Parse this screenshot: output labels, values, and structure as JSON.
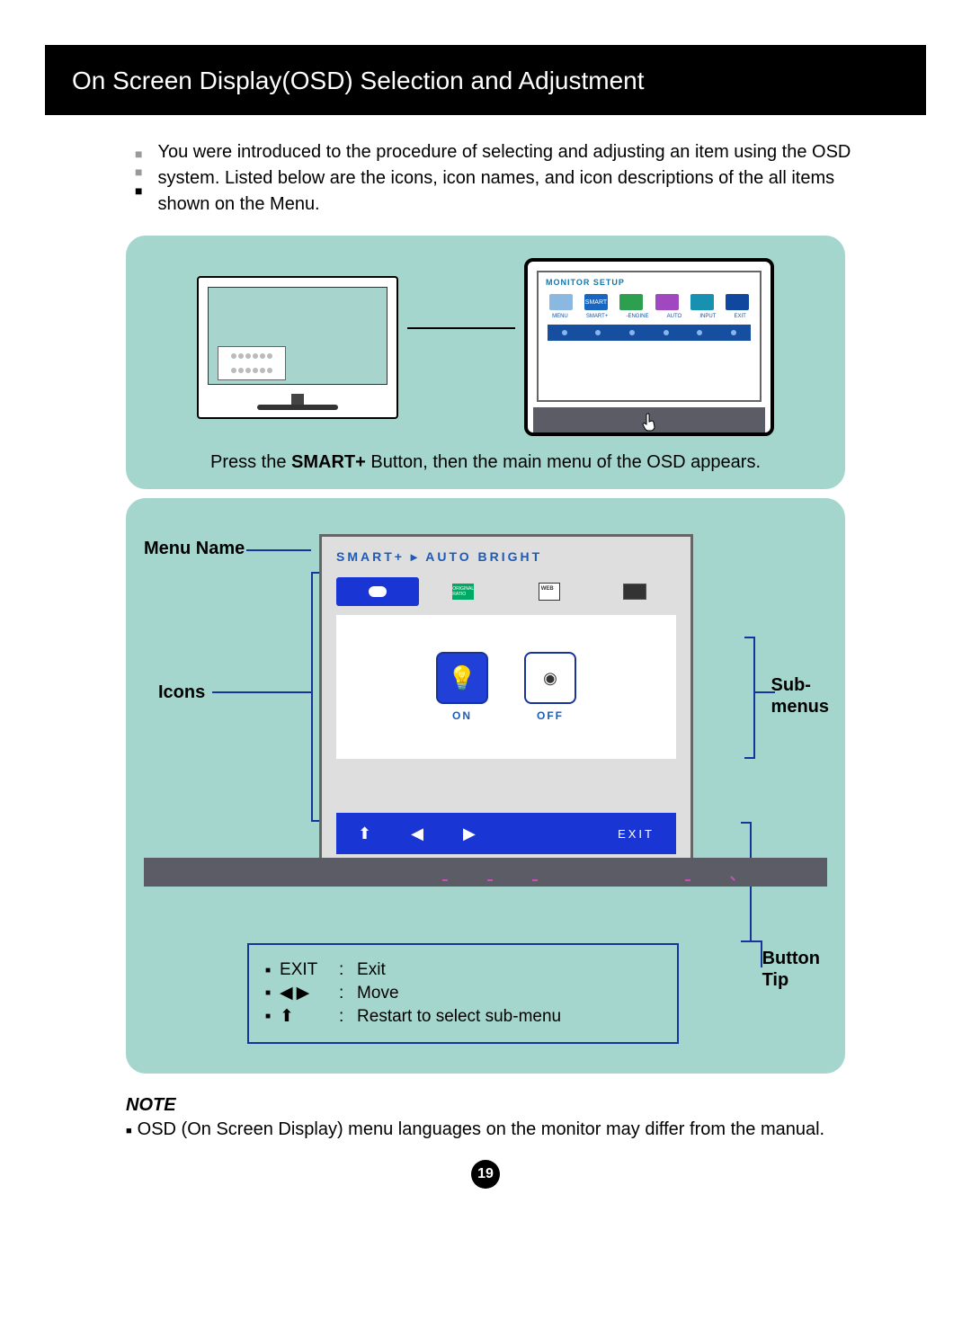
{
  "title": "On Screen Display(OSD) Selection and Adjustment",
  "intro": "You were introduced to the procedure of selecting and adjusting an item using the OSD system. Listed below are the icons, icon names, and icon descriptions of the all items shown on the Menu.",
  "panel1": {
    "osd_title": "MONITOR SETUP",
    "labels": [
      "MENU",
      "SMART+",
      "  -ENGINE",
      "AUTO",
      "INPUT",
      "EXIT"
    ],
    "ic2_text": "SMART",
    "caption_pre": "Press the ",
    "caption_bold": "SMART+",
    "caption_post": " Button, then the main menu of the OSD appears."
  },
  "panel2": {
    "labels": {
      "menu": "Menu Name",
      "icons": "Icons",
      "sub": "Sub-\nmenus",
      "button": "Button\nTip"
    },
    "osd": {
      "header": "SMART+ ▸ AUTO BRIGHT",
      "on": "ON",
      "off": "OFF",
      "exit": "EXIT",
      "ratio_text": "ORIGINAL RATIO"
    },
    "legend": {
      "r1k": "EXIT",
      "r1v": "Exit",
      "r2v": "Move",
      "r3v": "Restart to select sub-menu"
    }
  },
  "note": {
    "title": "NOTE",
    "text": "OSD (On Screen Display) menu languages on the monitor may differ from the manual."
  },
  "page_number": "19"
}
